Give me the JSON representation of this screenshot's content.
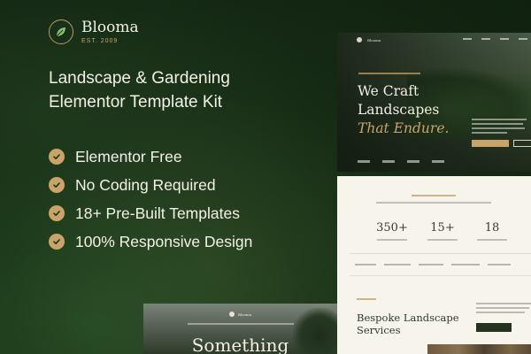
{
  "brand": {
    "name": "Blooma",
    "established": "EST. 2009",
    "logo_icon": "leaf-icon"
  },
  "headline": {
    "line1": "Landscape & Gardening",
    "line2": "Elementor Template Kit"
  },
  "features": [
    {
      "label": "Elementor Free",
      "icon": "check-circle-icon"
    },
    {
      "label": "No Coding Required",
      "icon": "check-circle-icon"
    },
    {
      "label": "18+ Pre-Built Templates",
      "icon": "check-circle-icon"
    },
    {
      "label": "100% Responsive Design",
      "icon": "check-circle-icon"
    }
  ],
  "preview_hero": {
    "brand": "Blooma",
    "title_line1": "We Craft",
    "title_line2": "Landscapes",
    "title_accent": "That Endure."
  },
  "preview_stats": {
    "items": [
      {
        "value": "350+"
      },
      {
        "value": "15+"
      },
      {
        "value": "18"
      }
    ],
    "section_title_line1": "Bespoke Landscape",
    "section_title_line2": "Services"
  },
  "preview_bottom": {
    "brand": "Blooma",
    "title": "Something"
  },
  "colors": {
    "accent": "#c9a468",
    "background": "#16301a",
    "light": "#f7f4ec"
  }
}
